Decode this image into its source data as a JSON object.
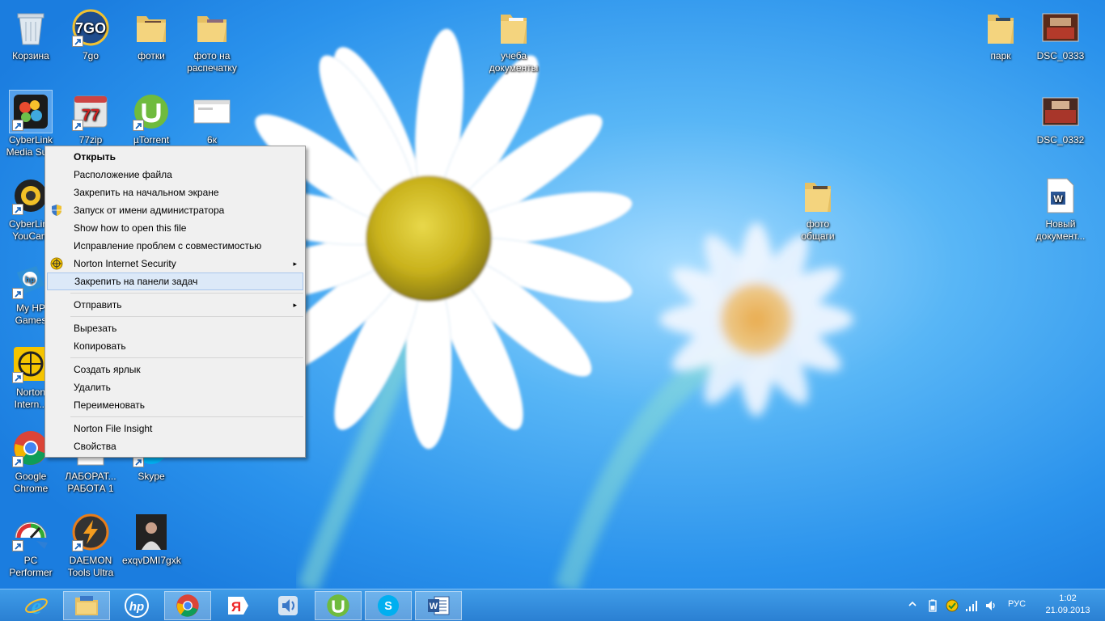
{
  "desktop": {
    "icons": [
      {
        "label": "Корзина",
        "icon": "recycle-bin-icon"
      },
      {
        "label": "7go",
        "icon": "7go-icon"
      },
      {
        "label": "фотки",
        "icon": "folder-icon"
      },
      {
        "label": "фото на распечатку",
        "icon": "folder-icon"
      },
      {
        "label": "учеба документы",
        "icon": "folder-icon"
      },
      {
        "label": "парк",
        "icon": "folder-icon"
      },
      {
        "label": "DSC_0333",
        "icon": "image-icon"
      },
      {
        "label": "CyberLink Media Su...",
        "icon": "cyberlink-icon"
      },
      {
        "label": "77zip",
        "icon": "77zip-icon"
      },
      {
        "label": "µTorrent",
        "icon": "utorrent-icon"
      },
      {
        "label": "6к",
        "icon": "window-icon"
      },
      {
        "label": "DSC_0332",
        "icon": "image-icon"
      },
      {
        "label": "CyberLink YouCam",
        "icon": "youcam-icon"
      },
      {
        "label": "фото общаги",
        "icon": "folder-icon"
      },
      {
        "label": "Новый документ...",
        "icon": "word-document-icon"
      },
      {
        "label": "My HP Games",
        "icon": "hp-games-icon"
      },
      {
        "label": "Norton Intern...",
        "icon": "norton-icon"
      },
      {
        "label": "Google Chrome",
        "icon": "chrome-icon"
      },
      {
        "label": "ЛАБОРАТ... РАБОТА 1",
        "icon": "word-document-icon"
      },
      {
        "label": "Skype",
        "icon": "skype-icon"
      },
      {
        "label": "PC Performer",
        "icon": "pc-performer-icon"
      },
      {
        "label": "DAEMON Tools Ultra",
        "icon": "daemon-tools-icon"
      },
      {
        "label": "exqvDMI7gxk",
        "icon": "photo-icon"
      }
    ]
  },
  "context_menu": {
    "items": [
      {
        "label": "Открыть"
      },
      {
        "label": "Расположение файла"
      },
      {
        "label": "Закрепить на начальном экране"
      },
      {
        "label": "Запуск от имени администратора"
      },
      {
        "label": "Show how to open this file"
      },
      {
        "label": "Исправление проблем с совместимостью"
      },
      {
        "label": "Norton Internet Security"
      },
      {
        "label": "Закрепить на панели задач"
      },
      {
        "label": "Отправить"
      },
      {
        "label": "Вырезать"
      },
      {
        "label": "Копировать"
      },
      {
        "label": "Создать ярлык"
      },
      {
        "label": "Удалить"
      },
      {
        "label": "Переименовать"
      },
      {
        "label": "Norton File Insight"
      },
      {
        "label": "Свойства"
      }
    ],
    "submenu_arrow": "▸"
  },
  "taskbar": {
    "buttons": [
      {
        "icon": "internet-explorer-icon"
      },
      {
        "icon": "file-explorer-icon"
      },
      {
        "icon": "hp-icon"
      },
      {
        "icon": "chrome-icon"
      },
      {
        "icon": "yandex-icon"
      },
      {
        "icon": "speaker-app-icon"
      },
      {
        "icon": "utorrent-icon"
      },
      {
        "icon": "skype-icon"
      },
      {
        "icon": "word-icon"
      }
    ],
    "tray": {
      "language": "РУС",
      "time": "1:02",
      "date": "21.09.2013"
    }
  },
  "colors": {
    "desktop_blue": "#2f97ee",
    "taskbar_blue": "#2a7fd2",
    "menu_background": "#f0f0f0",
    "menu_highlight": "#dce9f8"
  }
}
